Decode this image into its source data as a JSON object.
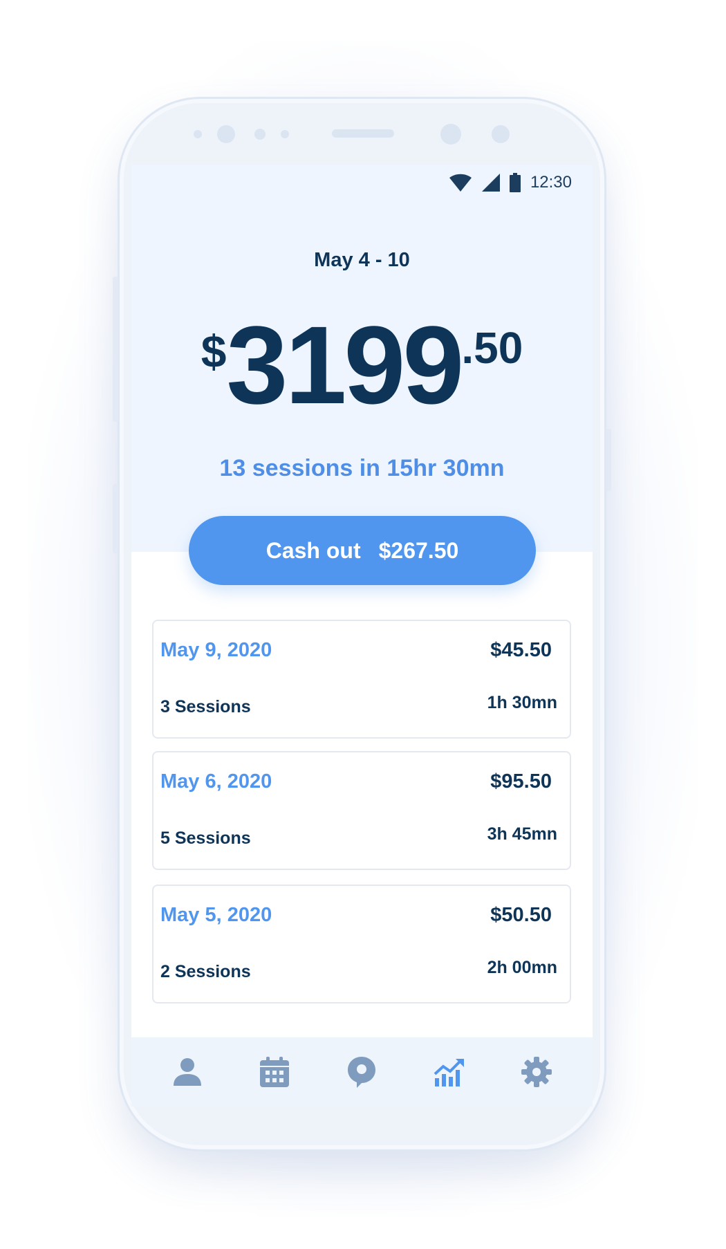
{
  "status_bar": {
    "time": "12:30",
    "icons": [
      "wifi-icon",
      "signal-icon",
      "battery-icon"
    ]
  },
  "summary": {
    "week": "May 4 - 10",
    "currency": "$",
    "amount_whole": "3199",
    "amount_cents": ".50",
    "sessions_text": "13 sessions in 15hr 30mn"
  },
  "cashout": {
    "label": "Cash out",
    "amount": "$267.50"
  },
  "days": [
    {
      "date": "May 9, 2020",
      "amount": "$45.50",
      "sessions": "3 Sessions",
      "duration": "1h 30mn"
    },
    {
      "date": "May 6, 2020",
      "amount": "$95.50",
      "sessions": "5 Sessions",
      "duration": "3h 45mn"
    },
    {
      "date": "May 5, 2020",
      "amount": "$50.50",
      "sessions": "2 Sessions",
      "duration": "2h 00mn"
    }
  ],
  "tabs": [
    {
      "icon": "profile-icon",
      "active": false
    },
    {
      "icon": "calendar-icon",
      "active": false
    },
    {
      "icon": "location-pin-icon",
      "active": false
    },
    {
      "icon": "earnings-chart-icon",
      "active": true
    },
    {
      "icon": "settings-gear-icon",
      "active": false
    }
  ],
  "colors": {
    "navy": "#0e3558",
    "accent": "#5196ee",
    "inactive_icon": "#7f9cbf"
  }
}
